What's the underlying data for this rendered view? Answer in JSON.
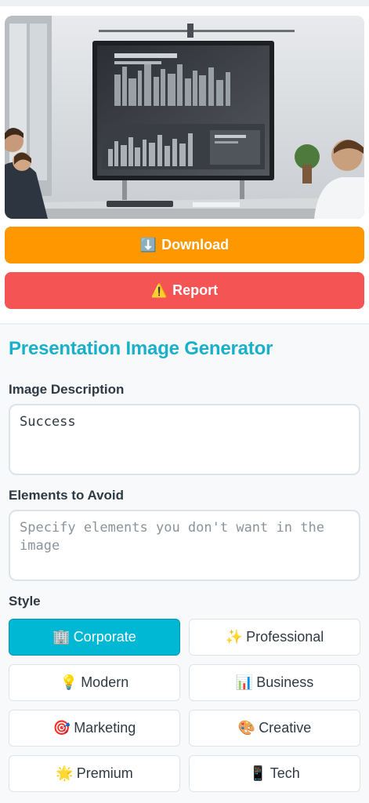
{
  "actions": {
    "download_icon": "⬇️",
    "download_label": "Download",
    "report_icon": "⚠️",
    "report_label": "Report"
  },
  "form": {
    "title": "Presentation Image Generator",
    "description": {
      "label": "Image Description",
      "value": "Success"
    },
    "avoid": {
      "label": "Elements to Avoid",
      "placeholder": "Specify elements you don't want in the image"
    },
    "style": {
      "label": "Style",
      "options": [
        {
          "icon": "🏢",
          "label": "Corporate",
          "selected": true
        },
        {
          "icon": "✨",
          "label": "Professional",
          "selected": false
        },
        {
          "icon": "💡",
          "label": "Modern",
          "selected": false
        },
        {
          "icon": "📊",
          "label": "Business",
          "selected": false
        },
        {
          "icon": "🎯",
          "label": "Marketing",
          "selected": false
        },
        {
          "icon": "🎨",
          "label": "Creative",
          "selected": false
        },
        {
          "icon": "🌟",
          "label": "Premium",
          "selected": false
        },
        {
          "icon": "📱",
          "label": "Tech",
          "selected": false
        }
      ]
    }
  },
  "colors": {
    "accent": "#1ab0c9",
    "selected_style": "#00b8d4",
    "download": "#ff9800",
    "report": "#f55454"
  }
}
